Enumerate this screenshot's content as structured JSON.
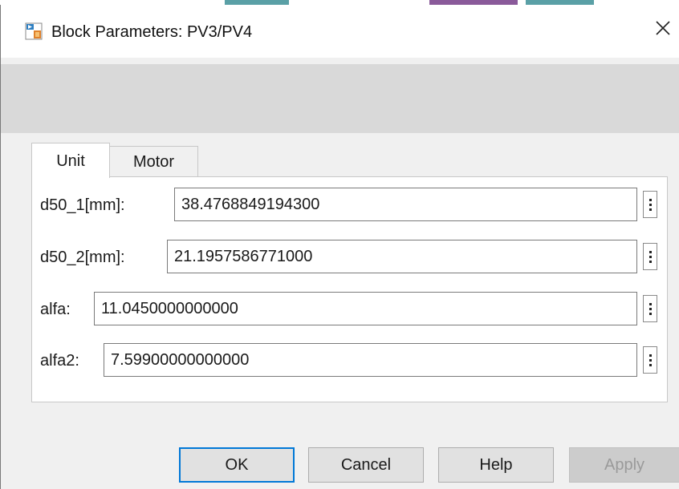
{
  "colors": {
    "strip_teal": "#5aa0a6",
    "strip_purple": "#8a5a9a",
    "accent_focus": "#0078d7",
    "window_bg": "#f0f0f0",
    "band_gray": "#d9d9d9"
  },
  "window": {
    "title": "Block Parameters: PV3/PV4",
    "app_icon": "simulink-block-icon",
    "close_glyph": "✕"
  },
  "tabs": [
    {
      "label": "Unit",
      "selected": true
    },
    {
      "label": "Motor",
      "selected": false
    }
  ],
  "params": [
    {
      "label": "d50_1[mm]:",
      "value": "38.4768849194300"
    },
    {
      "label": "d50_2[mm]:",
      "value": "21.1957586771000"
    },
    {
      "label": "alfa:",
      "value": "11.0450000000000"
    },
    {
      "label": "alfa2:",
      "value": "7.59900000000000"
    }
  ],
  "buttons": {
    "ok": "OK",
    "cancel": "Cancel",
    "help": "Help",
    "apply": "Apply"
  }
}
